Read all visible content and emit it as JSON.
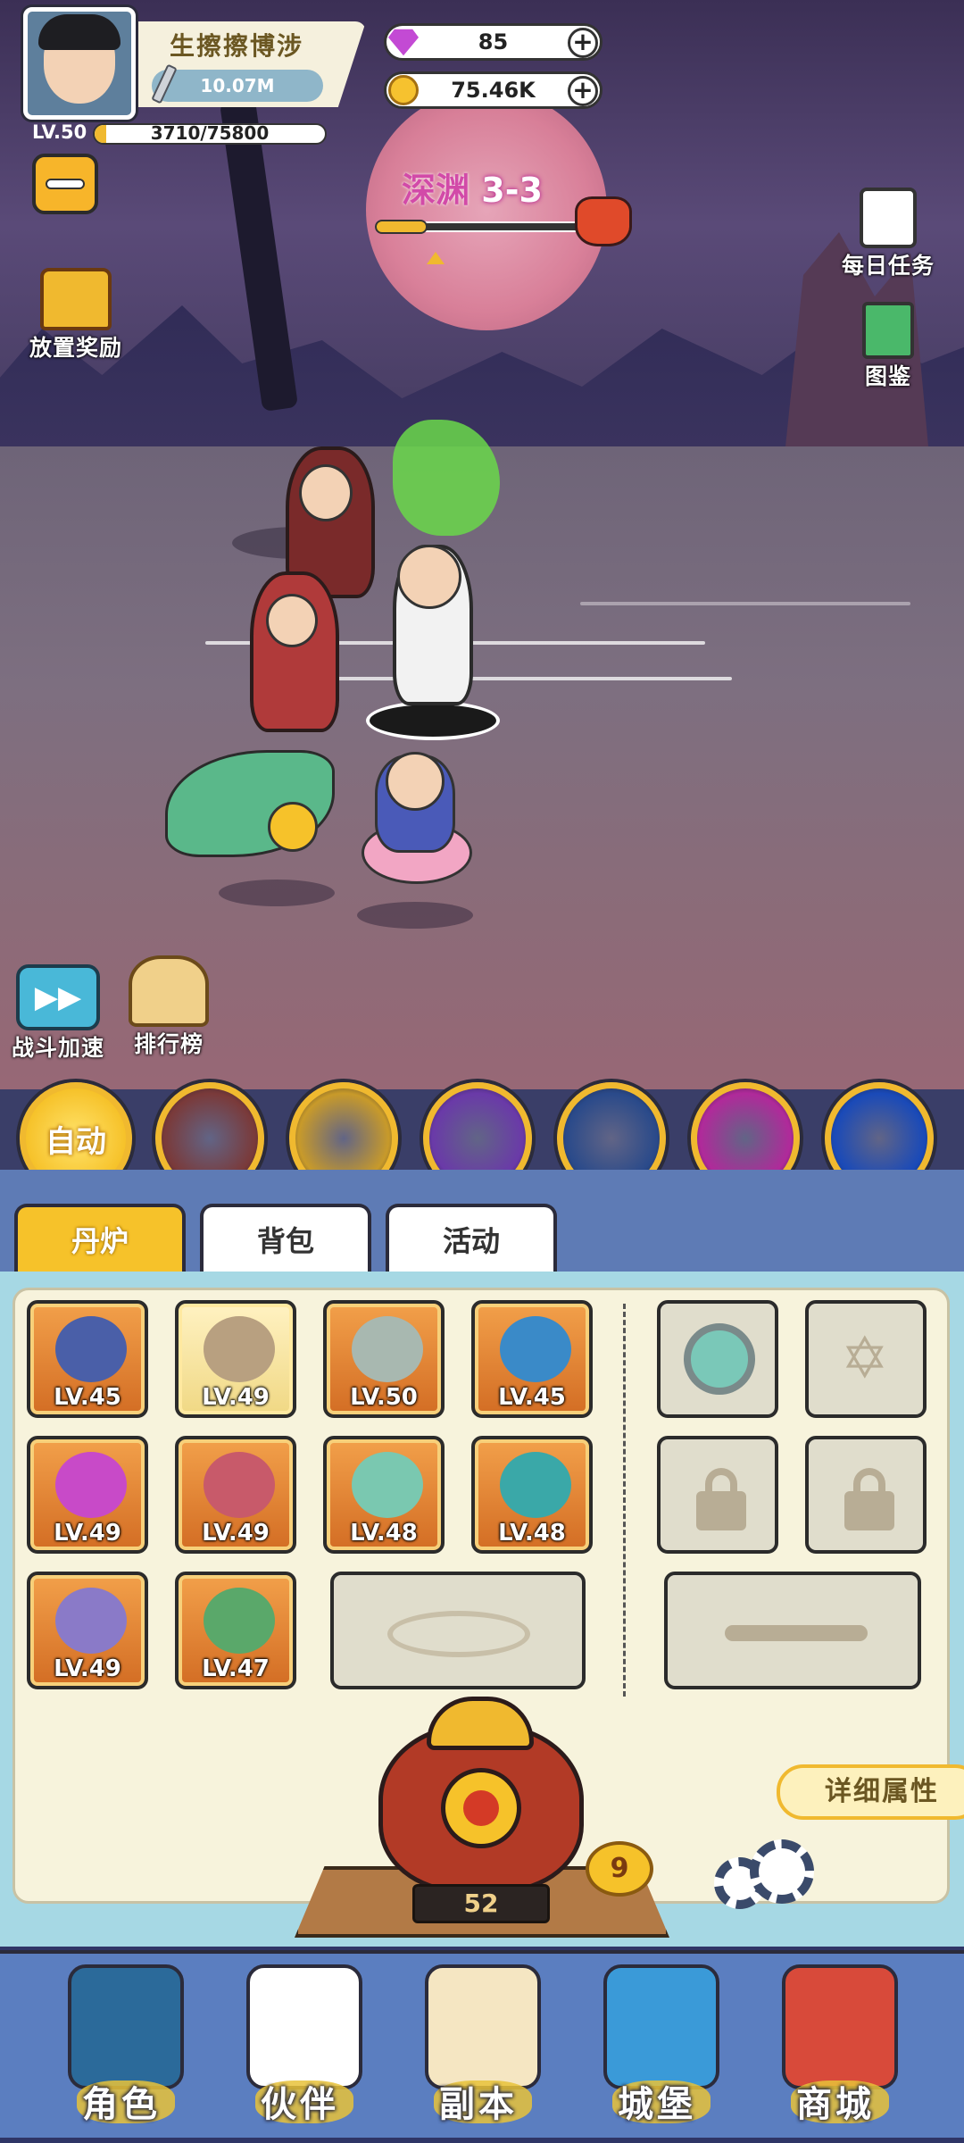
{
  "player": {
    "name": "生擦擦博涉",
    "power": "10.07M",
    "level": "LV.50",
    "exp_text": "3710/75800",
    "exp_fraction": 0.049
  },
  "currencies": {
    "gems": "85",
    "gold": "75.46K"
  },
  "side_menu": {
    "idle_reward": "放置奖励",
    "daily_tasks": "每日任务",
    "codex": "图鉴",
    "battle_speed": "战斗加速",
    "ranking": "排行榜"
  },
  "stage": {
    "name": "深渊",
    "number": "3-3",
    "progress_fraction": 0.25
  },
  "skills": {
    "auto_label": "自动",
    "slots": [
      {
        "icon": "beast-skill-icon",
        "color": "#7a3a3a"
      },
      {
        "icon": "sword-rain-skill-icon",
        "color": "#c89a2a"
      },
      {
        "icon": "purple-vortex-skill-icon",
        "color": "#6a3aa8"
      },
      {
        "icon": "lightning-talisman-skill-icon",
        "color": "#2a4a8a"
      },
      {
        "icon": "pink-spiral-skill-icon",
        "color": "#b02a9a"
      },
      {
        "icon": "blue-comet-skill-icon",
        "color": "#1a4ab8"
      }
    ]
  },
  "tabs": {
    "furnace": "丹炉",
    "bag": "背包",
    "events": "活动"
  },
  "equipment": [
    {
      "level": "LV.45",
      "icon": "spear-icon",
      "art": "#4a5fa8"
    },
    {
      "level": "LV.49",
      "icon": "horned-helmet-icon",
      "art": "#b8a080"
    },
    {
      "level": "LV.50",
      "icon": "armor-icon",
      "art": "#a8b8b0"
    },
    {
      "level": "LV.45",
      "icon": "phoenix-orb-icon",
      "art": "#3a8ac8"
    },
    {
      "level": "LV.49",
      "icon": "magic-flame-icon",
      "art": "#c84ac8"
    },
    {
      "level": "LV.49",
      "icon": "shield-icon",
      "art": "#c85a6a"
    },
    {
      "level": "LV.48",
      "icon": "jade-ring-icon",
      "art": "#7ac8b0"
    },
    {
      "level": "LV.48",
      "icon": "spirit-orb-icon",
      "art": "#3aa8a8"
    },
    {
      "level": "LV.49",
      "icon": "amulet-icon",
      "art": "#8a7ac8"
    },
    {
      "level": "LV.47",
      "icon": "boots-icon",
      "art": "#5aa86a"
    }
  ],
  "furnace": {
    "detail_label": "详细属性",
    "level": "52",
    "badge_count": "9"
  },
  "nav": {
    "character": "角色",
    "partner": "伙伴",
    "dungeon": "副本",
    "castle": "城堡",
    "shop": "商城"
  }
}
